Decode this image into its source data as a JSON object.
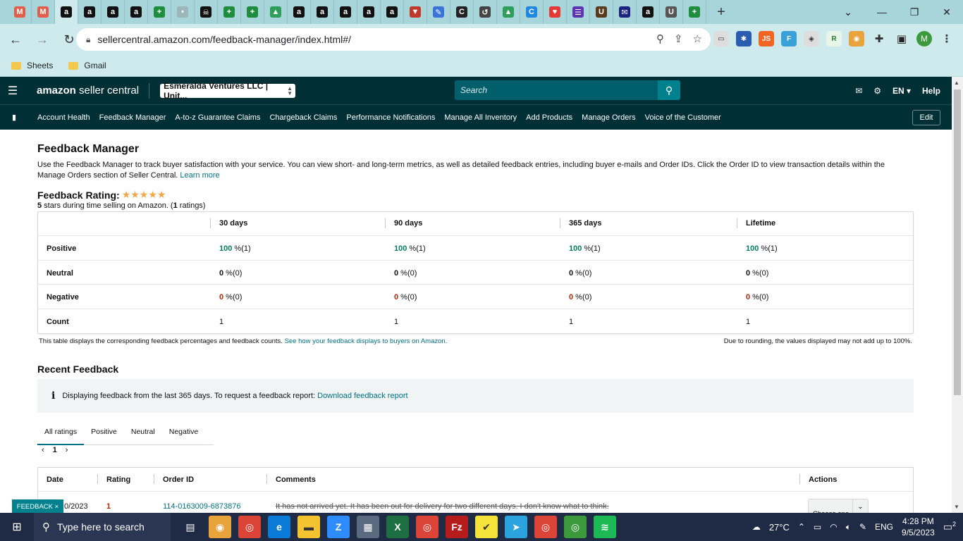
{
  "browser": {
    "tabs": [
      {
        "icon": "gmail-icon",
        "color": "#e35d4b",
        "glyph": "M"
      },
      {
        "icon": "gmail-icon",
        "color": "#e35d4b",
        "glyph": "M"
      },
      {
        "icon": "amazon-icon",
        "color": "#111111",
        "glyph": "a"
      },
      {
        "icon": "amazon-icon",
        "color": "#111111",
        "glyph": "a"
      },
      {
        "icon": "amazon-icon",
        "color": "#111111",
        "glyph": "a"
      },
      {
        "icon": "amazon-icon",
        "color": "#111111",
        "glyph": "a"
      },
      {
        "icon": "sheets-plus-icon",
        "color": "#1e8e3e",
        "glyph": "+"
      },
      {
        "icon": "loading-icon",
        "color": "#9bb7ba",
        "glyph": "•"
      },
      {
        "icon": "skull-icon",
        "color": "#111111",
        "glyph": "☠"
      },
      {
        "icon": "sheets-plus-icon",
        "color": "#1e8e3e",
        "glyph": "+"
      },
      {
        "icon": "sheets-plus-icon",
        "color": "#1e8e3e",
        "glyph": "+"
      },
      {
        "icon": "drive-icon",
        "color": "#2f9e5b",
        "glyph": "▲"
      },
      {
        "icon": "amazon-icon",
        "color": "#111111",
        "glyph": "a"
      },
      {
        "icon": "amazon-icon",
        "color": "#111111",
        "glyph": "a"
      },
      {
        "icon": "amazon-icon",
        "color": "#111111",
        "glyph": "a"
      },
      {
        "icon": "amazon-icon",
        "color": "#111111",
        "glyph": "a"
      },
      {
        "icon": "amazon-icon",
        "color": "#111111",
        "glyph": "a"
      },
      {
        "icon": "triangle-icon",
        "color": "#c0392b",
        "glyph": "▼"
      },
      {
        "icon": "pencil-icon",
        "color": "#3b74d9",
        "glyph": "✎"
      },
      {
        "icon": "c-icon",
        "color": "#222222",
        "glyph": "C"
      },
      {
        "icon": "history-icon",
        "color": "#444444",
        "glyph": "↺"
      },
      {
        "icon": "drive-icon",
        "color": "#2f9e5b",
        "glyph": "▲"
      },
      {
        "icon": "c-blue-icon",
        "color": "#1e88e5",
        "glyph": "C"
      },
      {
        "icon": "heart-icon",
        "color": "#e53935",
        "glyph": "♥"
      },
      {
        "icon": "list-icon",
        "color": "#5e35b1",
        "glyph": "☰"
      },
      {
        "icon": "ups-icon",
        "color": "#5a3a1a",
        "glyph": "U"
      },
      {
        "icon": "mail-flag-icon",
        "color": "#1a237e",
        "glyph": "✉"
      },
      {
        "icon": "amazon-icon",
        "color": "#111111",
        "glyph": "a"
      },
      {
        "icon": "uline-icon",
        "color": "#555555",
        "glyph": "U"
      },
      {
        "icon": "sheets-plus-icon",
        "color": "#1e8e3e",
        "glyph": "+"
      }
    ],
    "url": "sellercentral.amazon.com/feedback-manager/index.html#/",
    "bookmarks": [
      "Sheets",
      "Gmail"
    ],
    "profile_initial": "M"
  },
  "header": {
    "logo_bold": "amazon",
    "logo_rest": " seller central",
    "account": "Esmeralda Ventures LLC | Unit...",
    "search_placeholder": "Search",
    "lang": "EN",
    "help": "Help"
  },
  "nav": {
    "links": [
      "Account Health",
      "Feedback Manager",
      "A-to-z Guarantee Claims",
      "Chargeback Claims",
      "Performance Notifications",
      "Manage All Inventory",
      "Add Products",
      "Manage Orders",
      "Voice of the Customer"
    ],
    "edit": "Edit"
  },
  "page": {
    "title": "Feedback Manager",
    "description": "Use the Feedback Manager to track buyer satisfaction with your service. You can view short- and long-term metrics, as well as detailed feedback entries, including buyer e-mails and Order IDs. Click the Order ID to view transaction details within the Manage Orders section of Seller Central.",
    "learn_more": "Learn more",
    "rating_title": "Feedback Rating:",
    "stars": 5,
    "rating_sub_num": "5",
    "rating_sub_text": " stars during time selling on Amazon. (",
    "rating_sub_count": "1",
    "rating_sub_end": " ratings)"
  },
  "metrics": {
    "columns": [
      "30 days",
      "90 days",
      "365 days",
      "Lifetime"
    ],
    "rows": [
      {
        "label": "Positive",
        "cells": [
          {
            "pct": "100",
            "rest": " %(1)"
          },
          {
            "pct": "100",
            "rest": " %(1)"
          },
          {
            "pct": "100",
            "rest": " %(1)"
          },
          {
            "pct": "100",
            "rest": " %(1)"
          }
        ]
      },
      {
        "label": "Neutral",
        "cells": [
          {
            "pct": "0",
            "rest": " %(0)"
          },
          {
            "pct": "0",
            "rest": " %(0)"
          },
          {
            "pct": "0",
            "rest": " %(0)"
          },
          {
            "pct": "0",
            "rest": " %(0)"
          }
        ]
      },
      {
        "label": "Negative",
        "cells": [
          {
            "pct": "0",
            "rest": " %(0)"
          },
          {
            "pct": "0",
            "rest": " %(0)"
          },
          {
            "pct": "0",
            "rest": " %(0)"
          },
          {
            "pct": "0",
            "rest": " %(0)"
          }
        ]
      },
      {
        "label": "Count",
        "cells": [
          {
            "pct": "",
            "rest": "1"
          },
          {
            "pct": "",
            "rest": "1"
          },
          {
            "pct": "",
            "rest": "1"
          },
          {
            "pct": "",
            "rest": "1"
          }
        ]
      }
    ],
    "footnote_left": "This table displays the corresponding feedback percentages and feedback counts.",
    "footnote_link": "See how your feedback displays to buyers on Amazon.",
    "footnote_right": "Due to rounding, the values displayed may not add up to 100%."
  },
  "recent": {
    "title": "Recent Feedback",
    "info": "Displaying feedback from the last 365 days. To request a feedback report:",
    "info_link": "Download feedback report",
    "tabs": [
      "All ratings",
      "Positive",
      "Neutral",
      "Negative"
    ],
    "page": "1",
    "table_headers": [
      "Date",
      "Rating",
      "Order ID",
      "Comments",
      "Actions"
    ],
    "row": {
      "date": "0/2023",
      "rating": "1",
      "order_id": "114-0163009-6873876",
      "comment": "It has not arrived yet. It has been out for delivery for two different days. I don't know what to think.",
      "action": "Choose one"
    }
  },
  "feedback_tab": "FEEDBACK ×",
  "taskbar": {
    "search": "Type here to search",
    "weather": "27°C",
    "lang": "ENG",
    "time": "4:28 PM",
    "date": "9/5/2023",
    "notifications": "2"
  }
}
